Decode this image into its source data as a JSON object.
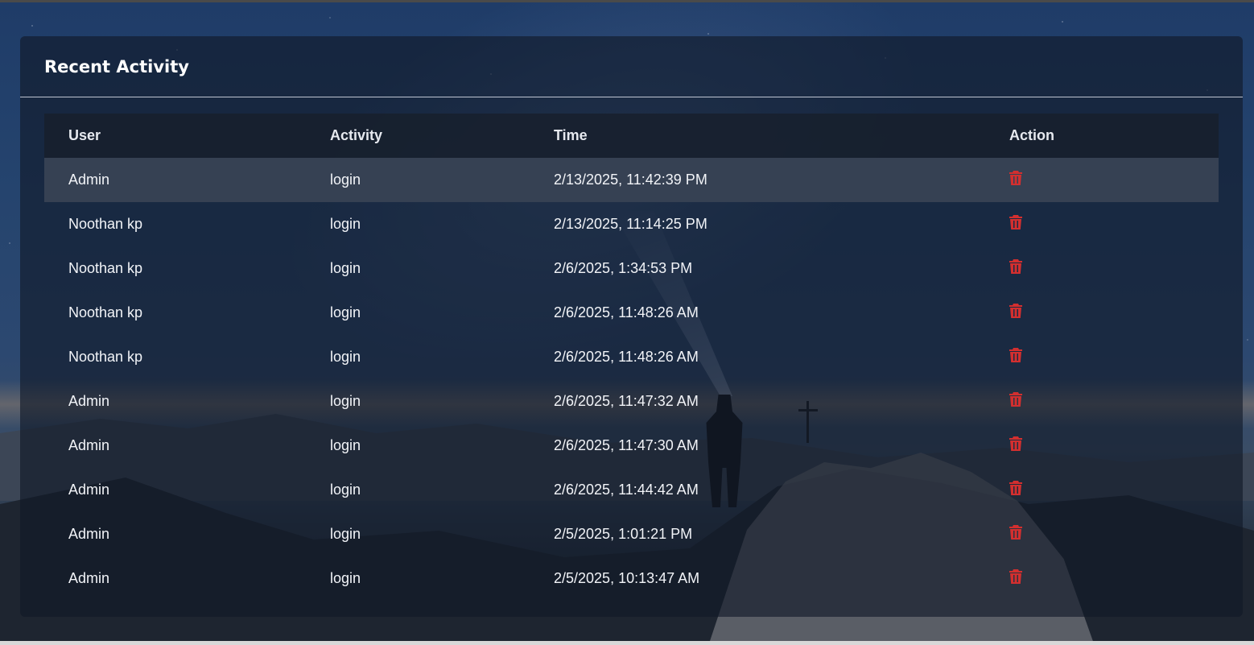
{
  "title": "Recent Activity",
  "columns": {
    "user": "User",
    "activity": "Activity",
    "time": "Time",
    "action": "Action"
  },
  "rows": [
    {
      "user": "Admin",
      "activity": "login",
      "time": "2/13/2025, 11:42:39 PM"
    },
    {
      "user": "Noothan kp",
      "activity": "login",
      "time": "2/13/2025, 11:14:25 PM"
    },
    {
      "user": "Noothan kp",
      "activity": "login",
      "time": "2/6/2025, 1:34:53 PM"
    },
    {
      "user": "Noothan kp",
      "activity": "login",
      "time": "2/6/2025, 11:48:26 AM"
    },
    {
      "user": "Noothan kp",
      "activity": "login",
      "time": "2/6/2025, 11:48:26 AM"
    },
    {
      "user": "Admin",
      "activity": "login",
      "time": "2/6/2025, 11:47:32 AM"
    },
    {
      "user": "Admin",
      "activity": "login",
      "time": "2/6/2025, 11:47:30 AM"
    },
    {
      "user": "Admin",
      "activity": "login",
      "time": "2/6/2025, 11:44:42 AM"
    },
    {
      "user": "Admin",
      "activity": "login",
      "time": "2/5/2025, 1:01:21 PM"
    },
    {
      "user": "Admin",
      "activity": "login",
      "time": "2/5/2025, 10:13:47 AM"
    }
  ],
  "action_icon": "trash-icon",
  "colors": {
    "delete": "#d32f2f",
    "highlight_row": "#384254",
    "header_row": "#18202e"
  }
}
